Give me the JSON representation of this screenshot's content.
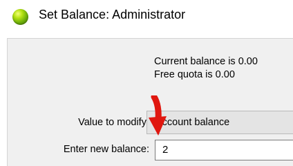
{
  "window": {
    "title": "Set Balance: Administrator",
    "icon": "green-status-orb-icon"
  },
  "info": {
    "current_balance": "Current balance is 0.00",
    "free_quota": "Free quota is 0.00"
  },
  "form": {
    "modify_label": "Value to modify:",
    "modify_value": "Account balance",
    "balance_label": "Enter new balance:",
    "balance_value": "2"
  },
  "annotation": {
    "icon": "red-arrow-icon",
    "color": "#e0170f"
  },
  "colors": {
    "panel_bg": "#f0f0f0",
    "select_bg": "#e4e4e4",
    "orb_green": "#6cad0a"
  }
}
